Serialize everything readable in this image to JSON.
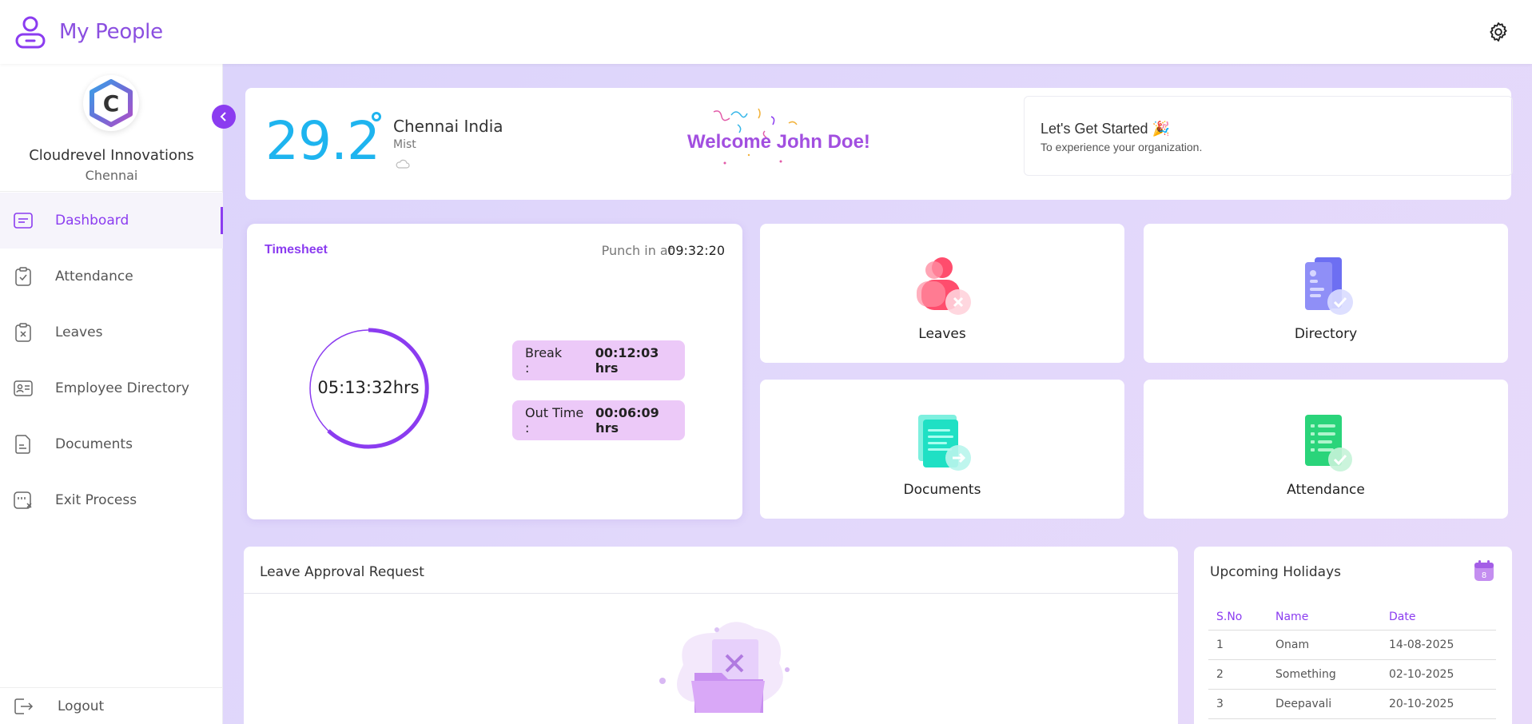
{
  "app": {
    "title": "My People"
  },
  "sidebar": {
    "org_name": "Cloudrevel Innovations",
    "org_city": "Chennai",
    "logo_letter": "C",
    "items": [
      {
        "label": "Dashboard",
        "icon": "dashboard-icon",
        "active": true
      },
      {
        "label": "Attendance",
        "icon": "clipboard-check-icon",
        "active": false
      },
      {
        "label": "Leaves",
        "icon": "clipboard-x-icon",
        "active": false
      },
      {
        "label": "Employee Directory",
        "icon": "id-card-icon",
        "active": false
      },
      {
        "label": "Documents",
        "icon": "document-icon",
        "active": false
      },
      {
        "label": "Exit Process",
        "icon": "exit-process-icon",
        "active": false
      }
    ],
    "logout_label": "Logout"
  },
  "weather": {
    "temp": "29.2",
    "city": "Chennai India",
    "description": "Mist"
  },
  "welcome": {
    "text": "Welcome John Doe!"
  },
  "get_started": {
    "title": "Let's Get Started 🎉",
    "subtitle": "To experience your organization."
  },
  "timesheet": {
    "title": "Timesheet",
    "punch_label": "Punch in at",
    "punch_time": "09:32:20",
    "elapsed": "05:13:32hrs",
    "break_label": "Break :",
    "break_value": "00:12:03 hrs",
    "out_label": "Out Time :",
    "out_value": "00:06:09 hrs"
  },
  "tiles": [
    {
      "label": "Leaves",
      "icon": "leaves-illustration"
    },
    {
      "label": "Directory",
      "icon": "directory-illustration"
    },
    {
      "label": "Documents",
      "icon": "documents-illustration"
    },
    {
      "label": "Attendance",
      "icon": "attendance-illustration"
    }
  ],
  "leave_approval": {
    "title": "Leave Approval Request"
  },
  "holidays": {
    "title": "Upcoming Holidays",
    "calendar_badge": "8",
    "columns": [
      "S.No",
      "Name",
      "Date"
    ],
    "rows": [
      {
        "sno": "1",
        "name": "Onam",
        "date": "14-08-2025"
      },
      {
        "sno": "2",
        "name": "Something",
        "date": "02-10-2025"
      },
      {
        "sno": "3",
        "name": "Deepavali",
        "date": "20-10-2025"
      }
    ]
  },
  "colors": {
    "accent": "#8b3cf0",
    "temp": "#1eb4ef",
    "welcome": "#a24fe0",
    "pill": "#ecc9f8"
  }
}
